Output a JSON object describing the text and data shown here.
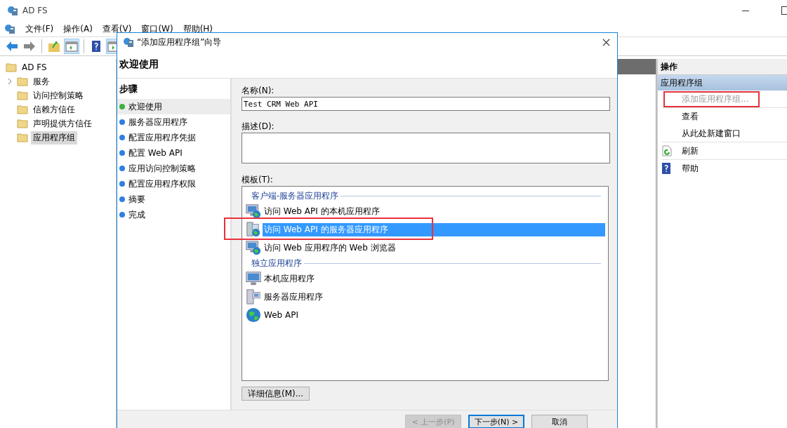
{
  "app": {
    "title": "AD FS"
  },
  "menu": [
    "文件(F)",
    "操作(A)",
    "查看(V)",
    "窗口(W)",
    "帮助(H)"
  ],
  "tree": {
    "label": "AD FS",
    "children": [
      {
        "label": "服务",
        "has_children": true,
        "selected": false
      },
      {
        "label": "访问控制策略",
        "has_children": false,
        "selected": false
      },
      {
        "label": "信赖方信任",
        "has_children": false,
        "selected": false
      },
      {
        "label": "声明提供方信任",
        "has_children": false,
        "selected": false
      },
      {
        "label": "应用程序组",
        "has_children": false,
        "selected": true
      }
    ]
  },
  "actions": {
    "header": "操作",
    "section": "应用程序组",
    "items": [
      {
        "label": "添加应用程序组...",
        "kind": "text",
        "disabled": true,
        "annotated": true,
        "group_end": true
      },
      {
        "label": "查看",
        "kind": "text",
        "disabled": false,
        "annotated": false,
        "group_end": false
      },
      {
        "label": "从此处新建窗口",
        "kind": "text",
        "disabled": false,
        "annotated": false,
        "group_end": true
      },
      {
        "label": "刷新",
        "kind": "refresh",
        "disabled": false,
        "annotated": false,
        "group_end": true
      },
      {
        "label": "帮助",
        "kind": "help",
        "disabled": false,
        "annotated": false,
        "group_end": false
      }
    ]
  },
  "dialog": {
    "title": "“添加应用程序组”向导",
    "heading": "欢迎使用",
    "steps_title": "步骤",
    "steps": [
      {
        "label": "欢迎使用",
        "selected": true
      },
      {
        "label": "服务器应用程序",
        "selected": false
      },
      {
        "label": "配置应用程序凭据",
        "selected": false
      },
      {
        "label": "配置 Web API",
        "selected": false
      },
      {
        "label": "应用访问控制策略",
        "selected": false
      },
      {
        "label": "配置应用程序权限",
        "selected": false
      },
      {
        "label": "摘要",
        "selected": false
      },
      {
        "label": "完成",
        "selected": false
      }
    ],
    "name_label": "名称(N):",
    "name_value": "Test CRM Web API",
    "description_label": "描述(D):",
    "template_label": "模板(T):",
    "template_groups": [
      {
        "title": "客户端-服务器应用程序",
        "items": [
          {
            "label": "访问 Web API 的本机应用程序",
            "kind": "client",
            "selected": false,
            "annotated": false
          },
          {
            "label": "访问 Web API 的服务器应用程序",
            "kind": "server-client",
            "selected": true,
            "annotated": true
          },
          {
            "label": "访问 Web 应用程序的 Web 浏览器",
            "kind": "client",
            "selected": false,
            "annotated": false
          }
        ]
      },
      {
        "title": "独立应用程序",
        "items": [
          {
            "label": "本机应用程序",
            "kind": "native",
            "selected": false,
            "annotated": false
          },
          {
            "label": "服务器应用程序",
            "kind": "server",
            "selected": false,
            "annotated": false
          },
          {
            "label": "Web API",
            "kind": "api",
            "selected": false,
            "annotated": false
          }
        ]
      }
    ],
    "details_button": "详细信息(M)...",
    "buttons": [
      {
        "label": "< 上一步(P)",
        "disabled": true,
        "default": false
      },
      {
        "label": "下一步(N) >",
        "disabled": false,
        "default": true
      },
      {
        "label": "取消",
        "disabled": false,
        "default": false
      }
    ]
  }
}
